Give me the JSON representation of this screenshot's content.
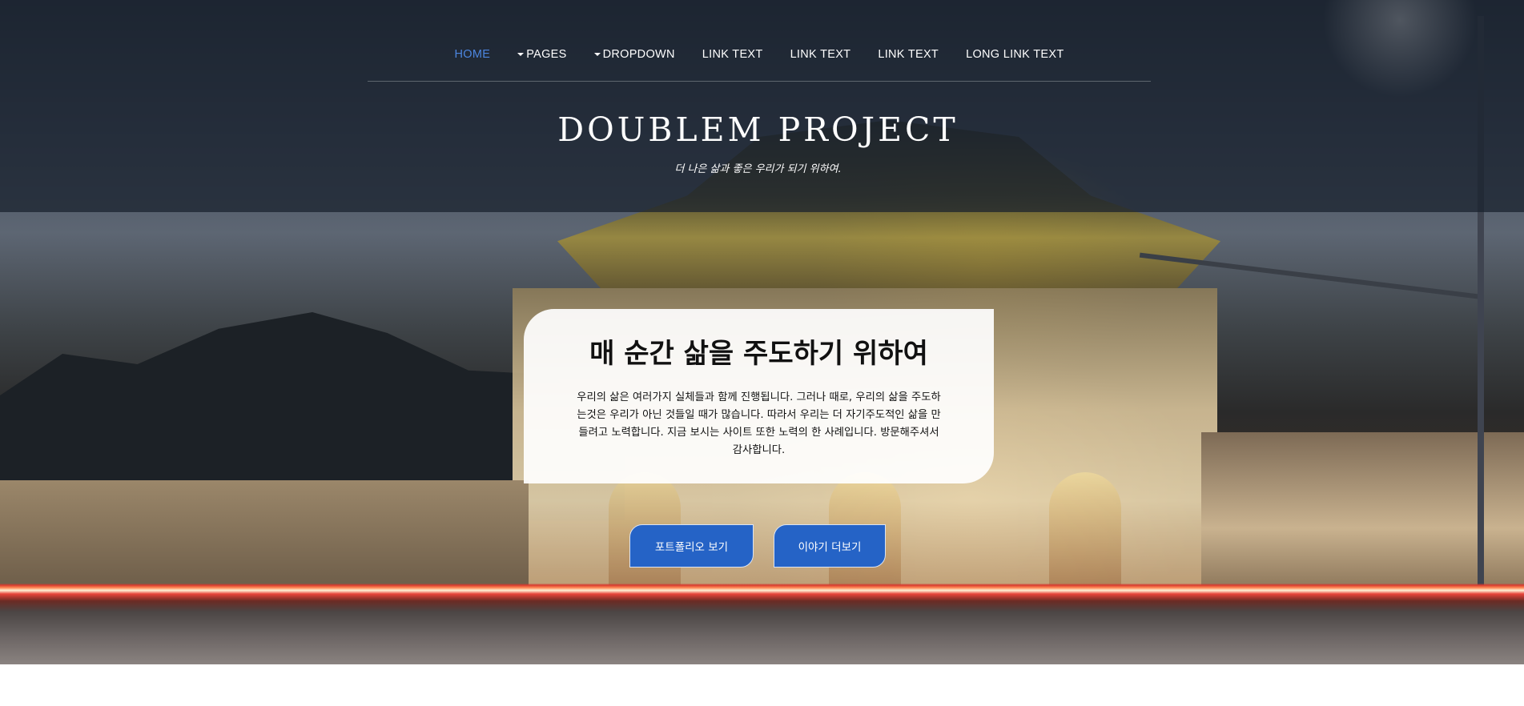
{
  "nav": {
    "items": [
      {
        "label": "HOME",
        "active": true,
        "dropdown": false
      },
      {
        "label": "PAGES",
        "active": false,
        "dropdown": true
      },
      {
        "label": "DROPDOWN",
        "active": false,
        "dropdown": true
      },
      {
        "label": "LINK TEXT",
        "active": false,
        "dropdown": false
      },
      {
        "label": "LINK TEXT",
        "active": false,
        "dropdown": false
      },
      {
        "label": "LINK TEXT",
        "active": false,
        "dropdown": false
      },
      {
        "label": "LONG LINK TEXT",
        "active": false,
        "dropdown": false
      }
    ],
    "active_color": "#4c86e0"
  },
  "header": {
    "title": "DOUBLEM PROJECT",
    "tagline": "더 나은 삶과 좋은 우리가 되기 위하여."
  },
  "card": {
    "title": "매 순간 삶을 주도하기 위하여",
    "lines": [
      "우리의 삶은 여러가지 실체들과 함께 진행됩니다. 그러나 때로, 우리의 삶을 주도하",
      "는것은 우리가 아닌 것들일 때가 많습니다. 따라서 우리는 더 자기주도적인 삶을 만",
      "들려고 노력합니다. 지금 보시는 사이트 또한 노력의 한 사례입니다. 방문해주셔서",
      "감사합니다."
    ]
  },
  "buttons": {
    "portfolio_label": "포트폴리오 보기",
    "story_label": "이야기 더보기",
    "color": "#2563c6"
  },
  "hero": {
    "image_icon": "gyeongbokgung-gate-night-photo"
  }
}
